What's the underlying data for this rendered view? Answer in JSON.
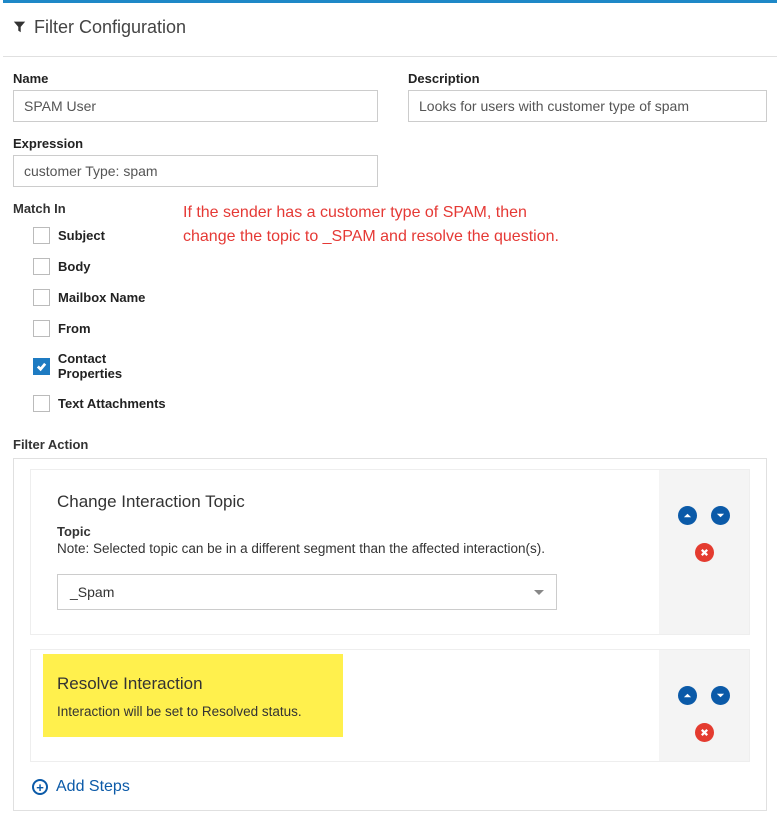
{
  "header": {
    "title": "Filter Configuration"
  },
  "form": {
    "name": {
      "label": "Name",
      "value": "SPAM User"
    },
    "description": {
      "label": "Description",
      "value": "Looks for users with customer type of spam"
    },
    "expression": {
      "label": "Expression",
      "value": "customer Type: spam"
    }
  },
  "matchIn": {
    "label": "Match In",
    "items": [
      {
        "label": "Subject",
        "checked": false
      },
      {
        "label": "Body",
        "checked": false
      },
      {
        "label": "Mailbox Name",
        "checked": false
      },
      {
        "label": "From",
        "checked": false
      },
      {
        "label": "Contact Properties",
        "checked": true
      },
      {
        "label": "Text Attachments",
        "checked": false
      }
    ]
  },
  "annotation": {
    "line1": "If the sender has a customer type of SPAM, then",
    "line2": "change the topic to _SPAM and resolve the question."
  },
  "filterAction": {
    "label": "Filter Action",
    "steps": [
      {
        "title": "Change Interaction Topic",
        "subLabel": "Topic",
        "note": "Note: Selected topic can be in a different segment than the affected interaction(s).",
        "selectValue": "_Spam"
      },
      {
        "title": "Resolve Interaction",
        "note": "Interaction will be set to Resolved status."
      }
    ],
    "addLabel": "Add Steps"
  }
}
